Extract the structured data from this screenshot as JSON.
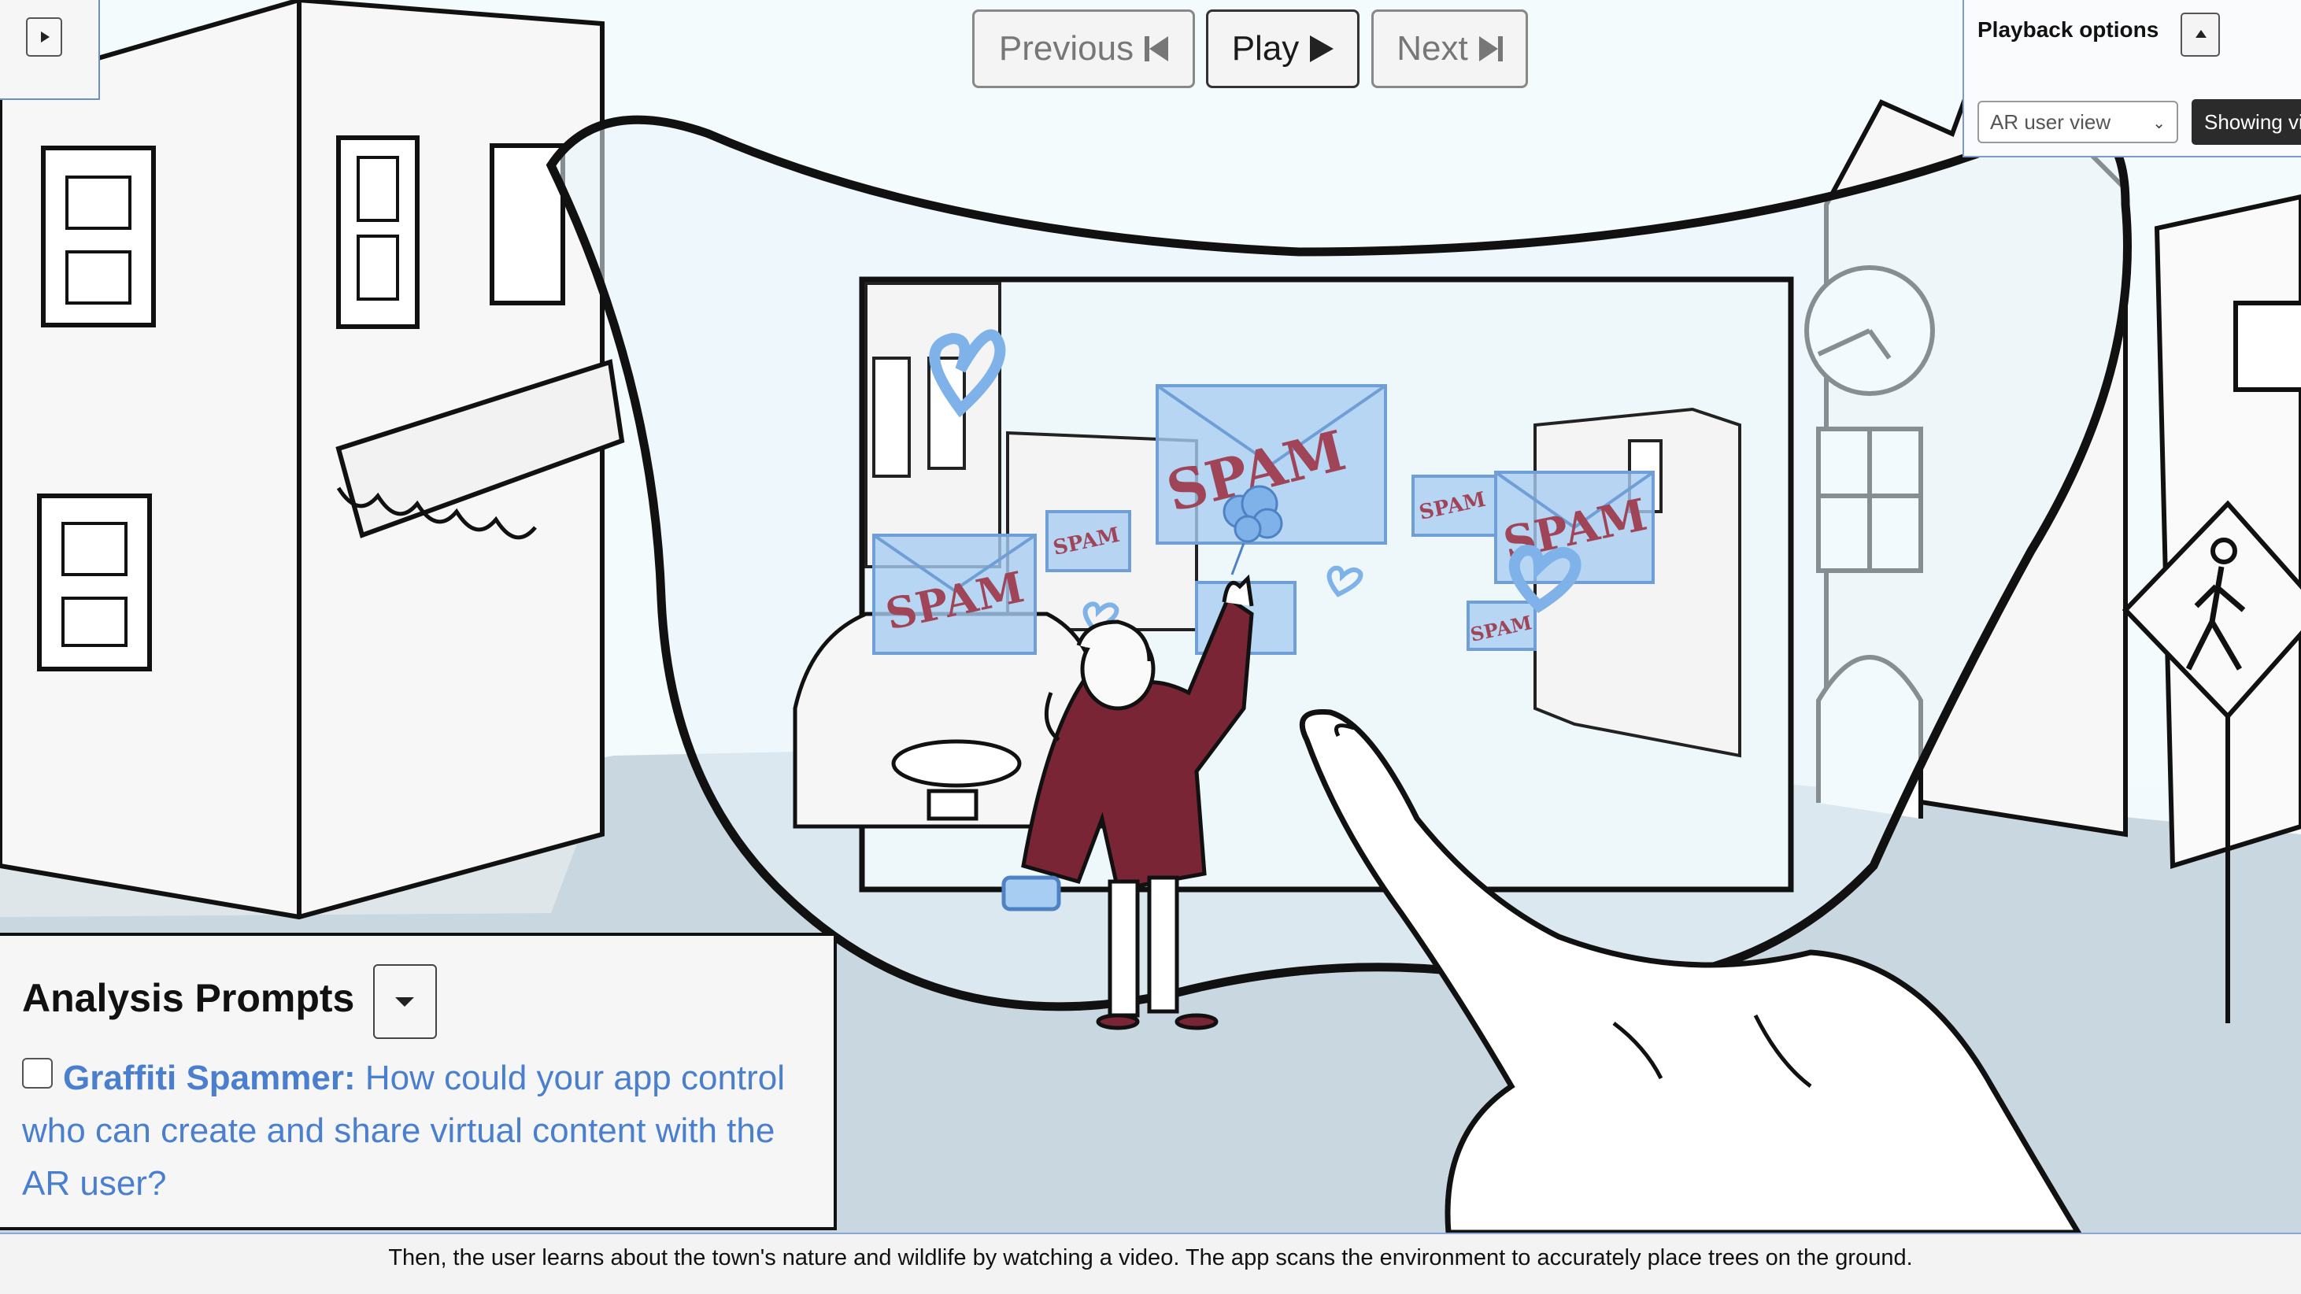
{
  "playback": {
    "previous_label": "Previous",
    "play_label": "Play",
    "next_label": "Next"
  },
  "options_panel": {
    "title": "Playback options",
    "view_select_value": "AR user view",
    "showing_label": "Showing vi"
  },
  "scene": {
    "billboard_text": "SPAM"
  },
  "analysis": {
    "title": "Analysis Prompts",
    "prompt_label": "Graffiti Spammer:",
    "prompt_text": " How could your app control who can create and share virtual content with the AR user?"
  },
  "caption": "Then, the user learns about the town's nature and wildlife by watching a video. The app scans the environment to accurately place trees on the ground.",
  "colors": {
    "link_blue": "#4a7fd0",
    "hoodie": "#7a2535",
    "hologram": "#a8cdf2"
  }
}
